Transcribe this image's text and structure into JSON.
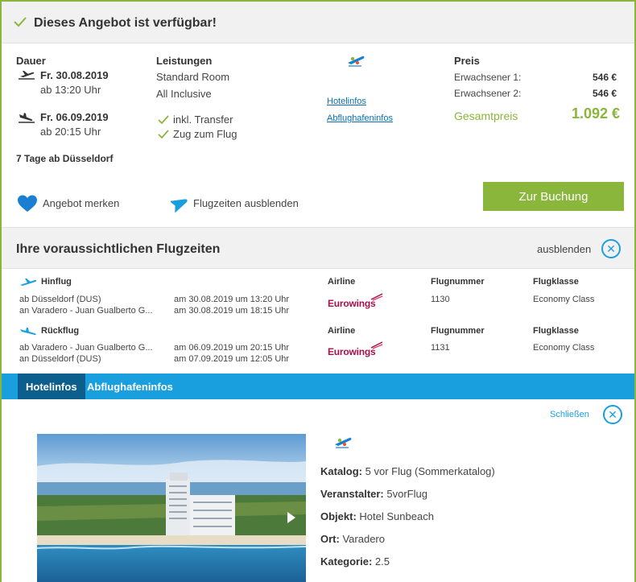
{
  "header": {
    "title": "Dieses Angebot ist verfügbar!"
  },
  "offer": {
    "duration_label": "Dauer",
    "outbound_date": "Fr. 30.08.2019",
    "outbound_time": "ab 13:20 Uhr",
    "return_date": "Fr. 06.09.2019",
    "return_time": "ab 20:15 Uhr",
    "trip_summary": "7 Tage ab Düsseldorf",
    "services_label": "Leistungen",
    "room": "Standard Room",
    "board": "All Inclusive",
    "transfer": "inkl. Transfer",
    "train": "Zug zum Flug",
    "hotel_info_link": "Hotelinfos",
    "airport_info_link": "Abflughafeninfos",
    "price_label": "Preis",
    "adult1_label": "Erwachsener 1:",
    "adult1_price": "546 €",
    "adult2_label": "Erwachsener 2:",
    "adult2_price": "546 €",
    "total_label": "Gesamtpreis",
    "total_price": "1.092 €",
    "save_offer": "Angebot merken",
    "hide_flights": "Flugzeiten ausblenden",
    "book_button": "Zur Buchung"
  },
  "flights": {
    "title": "Ihre voraussichtlichen Flugzeiten",
    "hide_label": "ausblenden",
    "col_airline": "Airline",
    "col_flightno": "Flugnummer",
    "col_class": "Flugklasse",
    "outbound": {
      "label": "Hinflug",
      "from": "ab Düsseldorf (DUS)",
      "to": "an Varadero - Juan Gualberto G...",
      "dep_time": "am 30.08.2019 um 13:20 Uhr",
      "arr_time": "am 30.08.2019 um 18:15 Uhr",
      "airline": "Eurowings",
      "flight_no": "1130",
      "class": "Economy Class"
    },
    "return": {
      "label": "Rückflug",
      "from": "ab Varadero - Juan Gualberto G...",
      "to": "an Düsseldorf (DUS)",
      "dep_time": "am 06.09.2019 um 20:15 Uhr",
      "arr_time": "am 07.09.2019 um 12:05 Uhr",
      "airline": "Eurowings",
      "flight_no": "1131",
      "class": "Economy Class"
    }
  },
  "tabs": [
    {
      "label": "Hotelinfos"
    },
    {
      "label": "Abflughafeninfos"
    }
  ],
  "hotel": {
    "close_label": "Schließen",
    "catalog_label": "Katalog:",
    "catalog": "5 vor Flug (Sommerkatalog)",
    "operator_label": "Veranstalter:",
    "operator": "5vorFlug",
    "object_label": "Objekt:",
    "object": "Hotel Sunbeach",
    "location_label": "Ort:",
    "location": "Varadero",
    "category_label": "Kategorie:",
    "category": "2.5"
  },
  "colors": {
    "accent_green": "#8ab63c",
    "accent_blue": "#1a9fde",
    "tab_active": "#0c5f8c",
    "link_blue": "#0a6fb5"
  }
}
